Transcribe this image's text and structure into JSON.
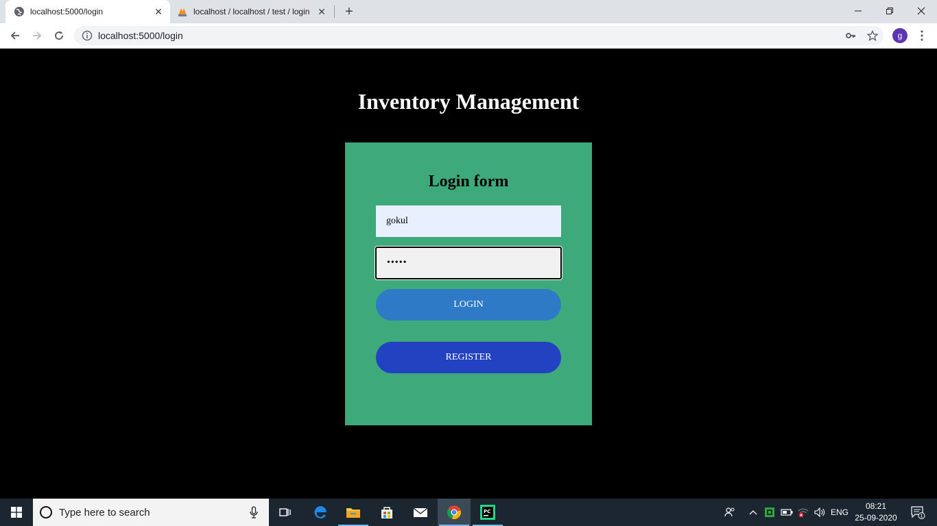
{
  "browser": {
    "tabs": [
      {
        "title": "localhost:5000/login",
        "active": true
      },
      {
        "title": "localhost / localhost / test / login",
        "active": false
      }
    ],
    "url": "localhost:5000/login",
    "profile_initial": "g"
  },
  "page": {
    "app_title": "Inventory Management",
    "form_title": "Login form",
    "username_value": "gokul",
    "password_value": "•••••",
    "login_label": "LOGIN",
    "register_label": "REGISTER"
  },
  "taskbar": {
    "search_placeholder": "Type here to search",
    "language": "ENG",
    "time": "08:21",
    "date": "25-09-2020",
    "notification_count": "1"
  },
  "colors": {
    "card_background": "#3eaa7c",
    "login_button": "#2f7ac7",
    "register_button": "#2342c2",
    "page_background": "#000000"
  }
}
